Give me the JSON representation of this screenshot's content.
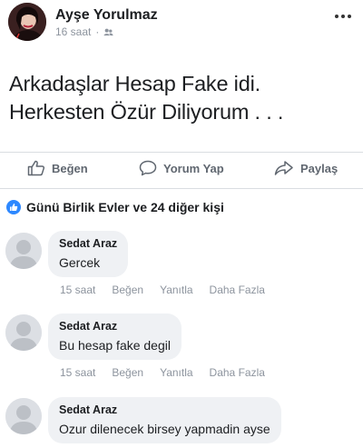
{
  "post": {
    "author": "Ayşe Yorulmaz",
    "time": "16 saat",
    "privacy_icon": "friends-icon",
    "text_lines": [
      "Arkadaşlar Hesap Fake idi.",
      "Herkesten Özür Diliyorum . . ."
    ]
  },
  "actions": {
    "like": "Beğen",
    "comment": "Yorum Yap",
    "share": "Paylaş"
  },
  "reactions": {
    "text": "Günü Birlik Evler ve 24 diğer kişi"
  },
  "comments": [
    {
      "author": "Sedat Araz",
      "text": "Gercek",
      "time": "15 saat",
      "like": "Beğen",
      "reply": "Yanıtla",
      "more": "Daha Fazla"
    },
    {
      "author": "Sedat Araz",
      "text": "Bu hesap fake degil",
      "time": "15 saat",
      "like": "Beğen",
      "reply": "Yanıtla",
      "more": "Daha Fazla"
    },
    {
      "author": "Sedat Araz",
      "text": "Ozur dilenecek birsey yapmadin ayse"
    }
  ],
  "colors": {
    "brand_blue": "#2d88ff",
    "meta_gray": "#8d949e",
    "bubble": "#eff1f4"
  }
}
